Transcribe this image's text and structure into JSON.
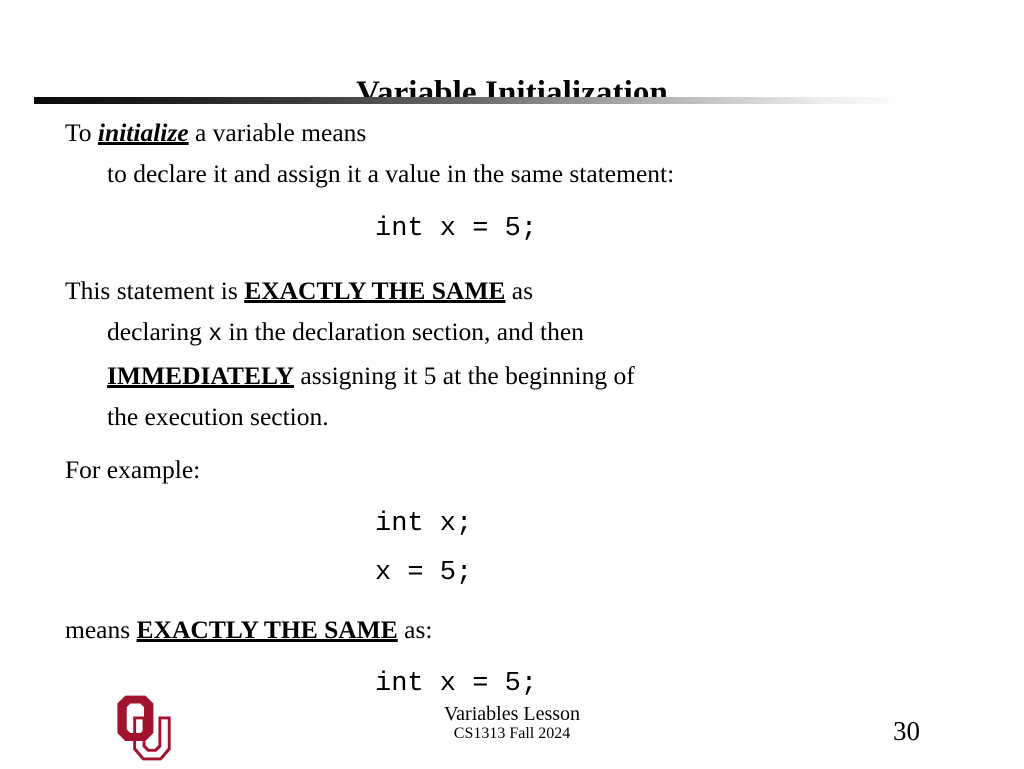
{
  "slide": {
    "title": "Variable Initialization",
    "page_number": "30",
    "background_color": "#ffffff",
    "text_color": "#000000",
    "rule": {
      "start_color": "#0a0a0a",
      "end_color": "#ffffff"
    }
  },
  "body": {
    "paragraph1": {
      "line1_pre": "To ",
      "line1_emph": "initialize",
      "line1_post": " a variable means",
      "line2": "to declare it and assign it a value in the same statement:"
    },
    "code1": "int x = 5;",
    "paragraph2": {
      "line1_pre": "This statement is ",
      "line1_emph": "EXACTLY THE SAME",
      "line1_post": " as",
      "line2_pre": "declaring ",
      "line2_mono": "x",
      "line2_post": " in the declaration section, and then",
      "line3_emph": "IMMEDIATELY",
      "line3_post": " assigning it 5 at the beginning of",
      "line4": "the execution section."
    },
    "paragraph3": {
      "line1": "For example:"
    },
    "code2_line1": "int x;",
    "code2_line2": "x = 5;",
    "paragraph4": {
      "line1_pre": "means ",
      "line1_emph": "EXACTLY THE SAME",
      "line1_post": " as:"
    },
    "code3": "int x = 5;"
  },
  "footer": {
    "logo_name": "ou-logo",
    "logo_color": "#a0122e",
    "lesson": "Variables Lesson",
    "course": "CS1313 Fall 2024"
  }
}
